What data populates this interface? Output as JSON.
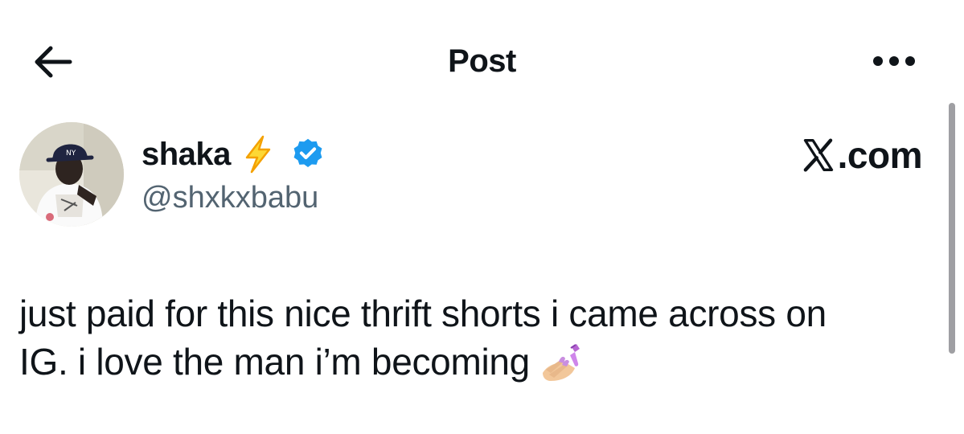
{
  "header": {
    "title": "Post",
    "back_icon": "arrow-left-icon",
    "more_icon": "more-horizontal-icon"
  },
  "post": {
    "author": {
      "name": "shaka",
      "name_emoji": "lightning-bolt-icon",
      "verified": true,
      "verified_color": "#1d9bf0",
      "handle": "@shxkxbabu"
    },
    "text_line1": "just paid for this nice thrift shorts i came across on",
    "text_line2": "IG. i love the man i’m becoming",
    "trailing_emoji": "nail-polish-icon"
  },
  "watermark": {
    "logo": "x-logo-icon",
    "text": ".com"
  },
  "colors": {
    "text_primary": "#0f1419",
    "text_secondary": "#536471",
    "accent": "#1d9bf0",
    "background": "#ffffff"
  }
}
